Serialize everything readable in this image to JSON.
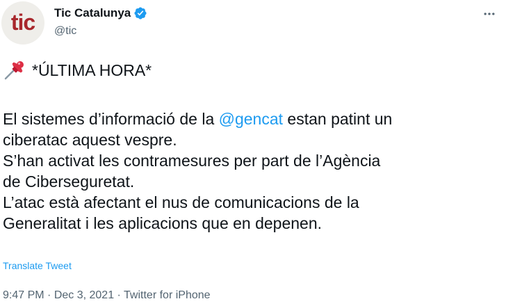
{
  "author": {
    "avatar_text": "tic",
    "display_name": "Tic Catalunya",
    "handle": "@tic",
    "verified": true
  },
  "tweet": {
    "headline": "*ÚLTIMA HORA*",
    "line1_pre": "El sistemes d’informació de la ",
    "mention": "@gencat",
    "line1_post": " estan patint un",
    "line2": "ciberatac aquest vespre.",
    "line3": "S’han activat les contramesures per part de l’Agència",
    "line4": "de Ciberseguretat.",
    "line5": "L’atac està afectant el nus de comunicacions de la",
    "line6": "Generalitat i les aplicacions que en depenen."
  },
  "translate_label": "Translate Tweet",
  "meta": {
    "time": "9:47 PM",
    "separator": " · ",
    "date": "Dec 3, 2021",
    "source": "Twitter for iPhone"
  },
  "colors": {
    "link": "#1d9bf0",
    "muted": "#536471",
    "text": "#0f1419",
    "avatar_brand": "#a8272c"
  },
  "icons": {
    "verified": "verified-badge-icon",
    "more": "more-horizontal-icon",
    "pin": "pushpin-icon"
  }
}
